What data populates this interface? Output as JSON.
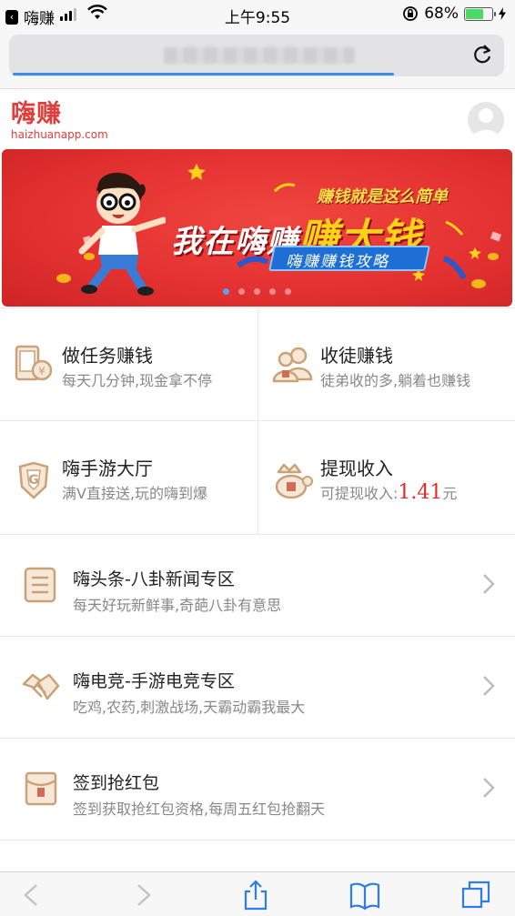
{
  "status_bar": {
    "back_app": "嗨赚",
    "time": "上午9:55",
    "battery_percent": "68%",
    "battery_level": 0.68
  },
  "address_bar": {
    "url_obscured": true,
    "load_progress": 0.77
  },
  "site": {
    "logo_cn": "嗨赚",
    "logo_en": "haizhuanapp.com"
  },
  "banner": {
    "headline_part1": "我在嗨赚",
    "headline_part2": "赚大钱",
    "tagline": "赚钱就是这么简单",
    "ribbon": "嗨赚赚钱攻略",
    "slides": 5,
    "active_slide": 1
  },
  "grid": [
    {
      "title": "做任务赚钱",
      "sub": "每天几分钟,现金拿不停",
      "icon": "task-phone-icon"
    },
    {
      "title": "收徒赚钱",
      "sub": "徒弟收的多,躺着也赚钱",
      "icon": "apprentice-people-icon"
    },
    {
      "title": "嗨手游大厅",
      "sub": "满V直接送,玩的嗨到爆",
      "icon": "game-shield-icon"
    },
    {
      "title": "提现收入",
      "sub_prefix": "可提现收入:",
      "amount": "1.41",
      "unit": "元",
      "icon": "money-bag-icon"
    }
  ],
  "list": [
    {
      "title": "嗨头条-八卦新闻专区",
      "sub": "每天好玩新鲜事,奇葩八卦有意思",
      "icon": "news-doc-icon"
    },
    {
      "title": "嗨电竞-手游电竞专区",
      "sub": "吃鸡,农药,刺激战场,天霸动霸我最大",
      "icon": "handshake-icon"
    },
    {
      "title": "签到抢红包",
      "sub": "签到获取抢红包资格,每周五红包抢翻天",
      "icon": "red-envelope-icon"
    }
  ],
  "colors": {
    "brand_red": "#e43b3b",
    "amount_red": "#e22a2a",
    "icon_tan": "#c9a27a",
    "progress_blue": "#3a8ee6",
    "ios_blue": "#2f7de1"
  }
}
